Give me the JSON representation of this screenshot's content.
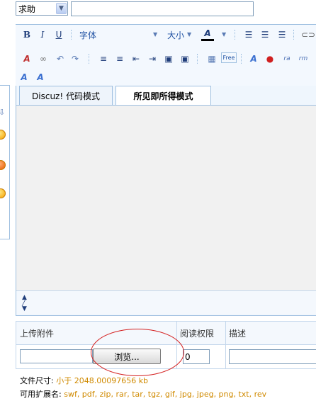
{
  "top": {
    "select_value": "求助",
    "input_value": ""
  },
  "toolbar": {
    "bold": "B",
    "italic": "I",
    "underline": "U",
    "font_label": "字体",
    "size_label": "大小",
    "color_a": "A",
    "free_label": "Free"
  },
  "tabs": [
    {
      "label": "Discuz! 代码模式"
    },
    {
      "label": "所见即所得模式"
    }
  ],
  "attachments": {
    "header_upload": "上传附件",
    "header_permission": "阅读权限",
    "header_description": "描述",
    "browse_label": "浏览...",
    "permission_value": "0",
    "description_value": ""
  },
  "info": {
    "size_label": "文件尺寸:",
    "size_value": "小于  2048.00097656 kb",
    "ext_label": "可用扩展名:",
    "ext_value": "swf, pdf, zip, rar, tar, tgz, gif, jpg, jpeg, png, txt, rev"
  },
  "colors": {
    "border": "#9ebfe0",
    "link_blue": "#1e50a2",
    "orange": "#d08a00",
    "annotation_red": "#d42020"
  }
}
